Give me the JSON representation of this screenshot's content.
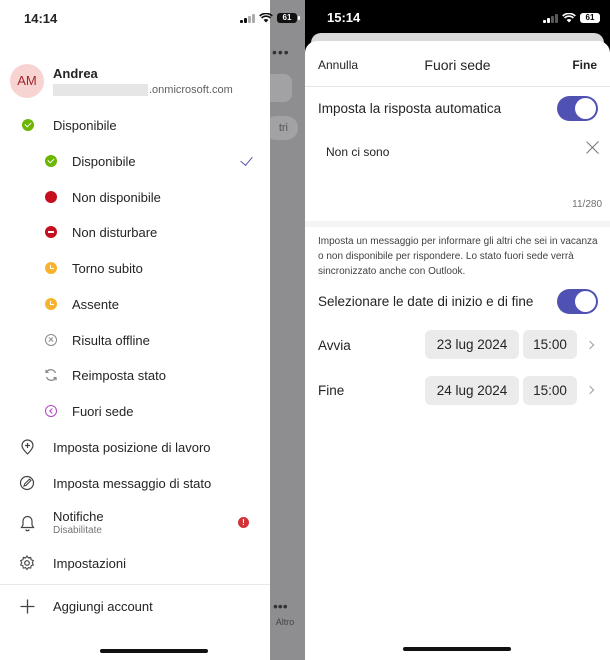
{
  "left": {
    "status_time": "14:14",
    "battery": "61",
    "profile": {
      "initials": "AM",
      "name": "Andrea",
      "email_domain": ".onmicrosoft.com"
    },
    "current_status": "Disponibile",
    "status_options": [
      {
        "label": "Disponibile",
        "icon": "available-icon",
        "selected": true
      },
      {
        "label": "Non disponibile",
        "icon": "busy-icon"
      },
      {
        "label": "Non disturbare",
        "icon": "do-not-disturb-icon"
      },
      {
        "label": "Torno subito",
        "icon": "be-right-back-icon"
      },
      {
        "label": "Assente",
        "icon": "away-icon"
      },
      {
        "label": "Risulta offline",
        "icon": "offline-icon"
      },
      {
        "label": "Reimposta stato",
        "icon": "reset-icon"
      },
      {
        "label": "Fuori sede",
        "icon": "out-of-office-icon"
      }
    ],
    "menu": {
      "work_location": "Imposta posizione di lavoro",
      "status_message": "Imposta messaggio di stato",
      "notifications": "Notifiche",
      "notifications_sub": "Disabilitate",
      "notifications_badge": "!",
      "settings": "Impostazioni",
      "add_account": "Aggiungi account"
    },
    "background": {
      "more_label": "Altro",
      "pill_label": "tri"
    }
  },
  "right": {
    "status_time": "15:14",
    "battery": "61",
    "nav": {
      "cancel": "Annulla",
      "title": "Fuori sede",
      "done": "Fine"
    },
    "auto_reply_label": "Imposta la risposta automatica",
    "auto_reply_on": true,
    "message": "Non ci sono",
    "char_count": "11/280",
    "description": "Imposta un messaggio per informare gli altri che sei in vacanza o non disponibile per rispondere. Lo stato fuori sede verrà sincronizzato anche con Outlook.",
    "dates_label": "Selezionare le date di inizio e di fine",
    "dates_on": true,
    "start": {
      "label": "Avvia",
      "date": "23 lug 2024",
      "time": "15:00"
    },
    "end": {
      "label": "Fine",
      "date": "24 lug 2024",
      "time": "15:00"
    },
    "accent": "#4f52b2"
  }
}
